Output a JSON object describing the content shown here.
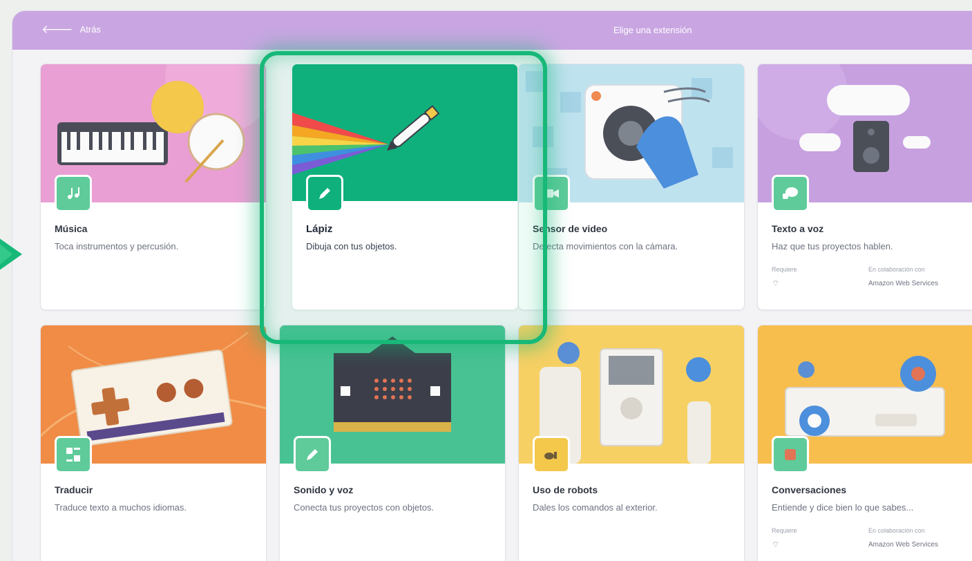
{
  "header": {
    "back_label": "Atrás",
    "title": "Elige una extensión"
  },
  "colors": {
    "header": "#c9a6e2",
    "highlight": "#17b878",
    "pen_green": "#0fb07c"
  },
  "cards": [
    {
      "title": "Música",
      "desc": "Toca instrumentos y percusión."
    },
    {
      "title": "Lápiz",
      "desc": "Dibuja con tus objetos."
    },
    {
      "title": "Sensor de video",
      "desc": "Detecta movimientos con la cámara."
    },
    {
      "title": "Texto a voz",
      "desc": "Haz que tus proyectos hablen.",
      "requires": "Requiere",
      "collab_label": "En colaboración con",
      "collab": "Amazon Web Services"
    },
    {
      "title": "Traducir",
      "desc": "Traduce texto a muchos idiomas."
    },
    {
      "title": "Sonido y voz",
      "desc": "Conecta tus proyectos con objetos."
    },
    {
      "title": "Uso de robots",
      "desc": "Dales los comandos al exterior."
    },
    {
      "title": "Conversaciones",
      "desc": "Entiende y dice bien lo que sabes...",
      "requires": "Requiere",
      "collab_label": "En colaboración con",
      "collab": "Amazon Web Services"
    }
  ]
}
